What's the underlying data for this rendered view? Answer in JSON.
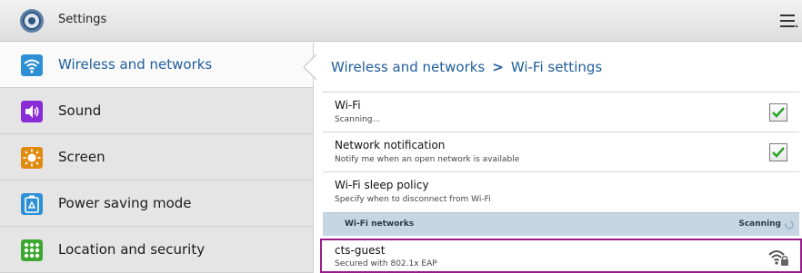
{
  "app": {
    "title": "Settings",
    "icon": "settings-gear-icon",
    "menu_icon": "overflow-menu-icon"
  },
  "sidebar": {
    "items": [
      {
        "label": "Wireless and networks",
        "icon": "wifi-icon",
        "active": true,
        "color": "#2d8fd5"
      },
      {
        "label": "Sound",
        "icon": "speaker-icon",
        "active": false,
        "color": "#8a2bd8"
      },
      {
        "label": "Screen",
        "icon": "brightness-icon",
        "active": false,
        "color": "#e08a10"
      },
      {
        "label": "Power saving mode",
        "icon": "recycle-battery-icon",
        "active": false,
        "color": "#2d8fd5"
      },
      {
        "label": "Location and security",
        "icon": "location-grid-icon",
        "active": false,
        "color": "#3aa82e"
      }
    ]
  },
  "breadcrumb": {
    "parent": "Wireless and networks",
    "separator": ">",
    "current": "Wi-Fi settings"
  },
  "settings": {
    "wifi": {
      "title": "Wi-Fi",
      "subtitle": "Scanning...",
      "checked": true
    },
    "network_notification": {
      "title": "Network notification",
      "subtitle": "Notify me when an open network is available",
      "checked": true
    },
    "sleep_policy": {
      "title": "Wi-Fi sleep policy",
      "subtitle": "Specify when to disconnect from Wi-Fi"
    }
  },
  "networks_section": {
    "title": "Wi-Fi networks",
    "status": "Scanning"
  },
  "networks": [
    {
      "name": "cts-guest",
      "security": "Secured with 802.1x EAP",
      "icon": "wifi-signal-lock-icon"
    }
  ],
  "colors": {
    "accent": "#1f5e9c",
    "check": "#2aa52a",
    "highlight_border": "#9a1c8a",
    "section_bg": "#c6d6e3"
  }
}
